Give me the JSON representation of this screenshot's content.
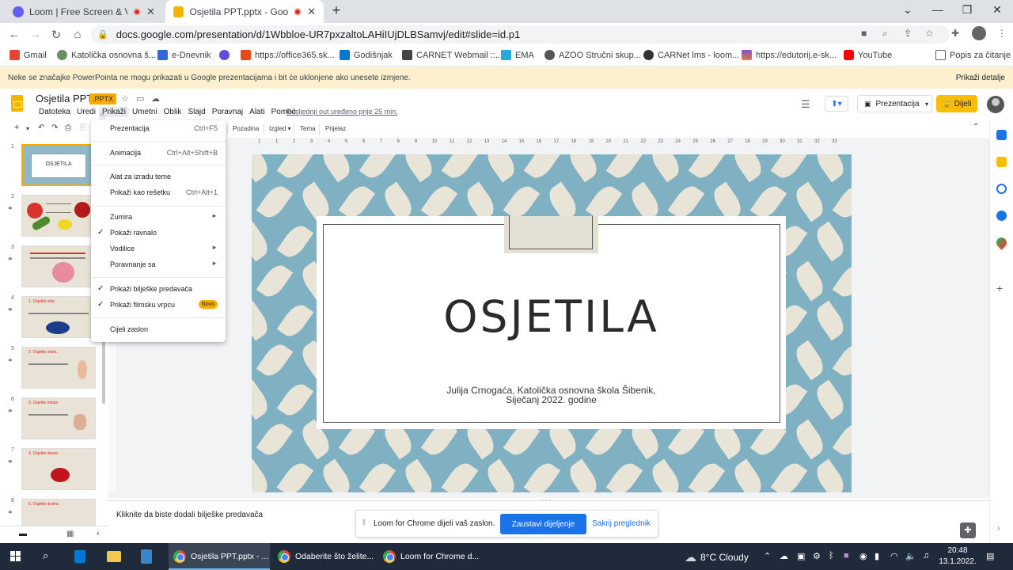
{
  "browser": {
    "tabs": [
      {
        "title": "Loom | Free Screen & Video",
        "active": false
      },
      {
        "title": "Osjetila PPT.pptx - Google p",
        "active": true
      }
    ],
    "url": "docs.google.com/presentation/d/1Wbbloe-UR7pxzaltoLAHiIUjDLBSamvj/edit#slide=id.p1"
  },
  "bookmarks": [
    {
      "label": "Gmail",
      "color": "#ea4335"
    },
    {
      "label": "Katolička osnovna š...",
      "color": "#6a8f5f"
    },
    {
      "label": "e-Dnevnik",
      "color": "#3367d6"
    },
    {
      "label": "",
      "color": "#5b4fd8"
    },
    {
      "label": "https://office365.sk...",
      "color": "#e64a19"
    },
    {
      "label": "Godišnjak",
      "color": "#0078d4"
    },
    {
      "label": "CARNET Webmail ::...",
      "color": "#444444"
    },
    {
      "label": "EMA",
      "color": "#29a8e0"
    },
    {
      "label": "AZOO Stručni skup...",
      "color": "#555555"
    },
    {
      "label": "CARNet lms - loom...",
      "color": "#333333"
    },
    {
      "label": "https://edutorij.e-sk...",
      "color": "#7b4fcf"
    },
    {
      "label": "YouTube",
      "color": "#ff0000"
    }
  ],
  "reading_list": "Popis za čitanje",
  "infobar": {
    "message": "Neke se značajke PowerPointa ne mogu prikazati u Google prezentacijama i bit će uklonjene ako unesete izmjene.",
    "link": "Prikaži detalje"
  },
  "doc": {
    "title": "Osjetila PPT",
    "badge": ".PPTX",
    "last_edit": "Posljednji out uređeno prije 25 min.",
    "menu": [
      "Datoteka",
      "Uredi",
      "Prikaži",
      "Umetni",
      "Oblik",
      "Slajd",
      "Poravnaj",
      "Alati",
      "Pomoć"
    ],
    "present_label": "Prezentacija",
    "share_label": "Dijeli"
  },
  "slide_toolbar": {
    "background": "Pozadina",
    "layout": "Izgled",
    "theme": "Tema",
    "transition": "Prijelaz"
  },
  "view_menu": {
    "items": [
      {
        "label": "Prezentacija",
        "shortcut": "Ctrl+F5"
      },
      {
        "label": "Animacija",
        "shortcut": "Ctrl+Alt+Shift+B"
      },
      {
        "label": "Alat za izradu teme",
        "shortcut": ""
      },
      {
        "label": "Prikaži kao rešetku",
        "shortcut": "Ctrl+Alt+1"
      },
      {
        "label": "Zumira",
        "shortcut": ""
      },
      {
        "label": "Pokaži ravnalo",
        "shortcut": ""
      },
      {
        "label": "Vodilice",
        "shortcut": ""
      },
      {
        "label": "Poravnanje sa",
        "shortcut": ""
      },
      {
        "label": "Prikaži bilješke predavača",
        "shortcut": ""
      },
      {
        "label": "Prikaži filmsku vrpcu",
        "shortcut": ""
      },
      {
        "label": "Cijeli zaslon",
        "shortcut": ""
      }
    ],
    "new_badge": "Novo"
  },
  "ruler_ticks": [
    "1",
    "1",
    "2",
    "3",
    "4",
    "5",
    "6",
    "7",
    "8",
    "9",
    "10",
    "11",
    "12",
    "13",
    "14",
    "15",
    "16",
    "17",
    "18",
    "19",
    "20",
    "21",
    "22",
    "23",
    "24",
    "25",
    "26",
    "27",
    "28",
    "29",
    "30",
    "31",
    "32",
    "33"
  ],
  "slide": {
    "title": "OSJETILA",
    "subtitle_line1": "Julija Crnogaća, Katolička osnovna škola Šibenik,",
    "subtitle_line2": "Siječanj 2022. godine"
  },
  "thumbnails": [
    {
      "num": "1",
      "title": "OSJETILA"
    },
    {
      "num": "2",
      "title": ""
    },
    {
      "num": "3",
      "title": ""
    },
    {
      "num": "4",
      "title": "1. Osjetilo vida"
    },
    {
      "num": "5",
      "title": "2. Osjetilo sluha"
    },
    {
      "num": "6",
      "title": "3. Osjetilo mirisa"
    },
    {
      "num": "7",
      "title": "4. Osjetilo okusa"
    },
    {
      "num": "8",
      "title": "5. Osjetilo dodira"
    }
  ],
  "notes_placeholder": "Kliknite da biste dodali bilješke predavača",
  "loom": {
    "message": "Loom for Chrome dijeli vaš zaslon.",
    "stop": "Zaustavi dijeljenje",
    "hide": "Sakrij preglednik"
  },
  "taskbar": {
    "apps": [
      {
        "label": "Osjetila PPT.pptx - ..."
      },
      {
        "label": "Odaberite što želite..."
      },
      {
        "label": "Loom for Chrome d..."
      }
    ],
    "weather": "8°C  Cloudy",
    "time": "20:48",
    "date": "13.1.2022."
  }
}
